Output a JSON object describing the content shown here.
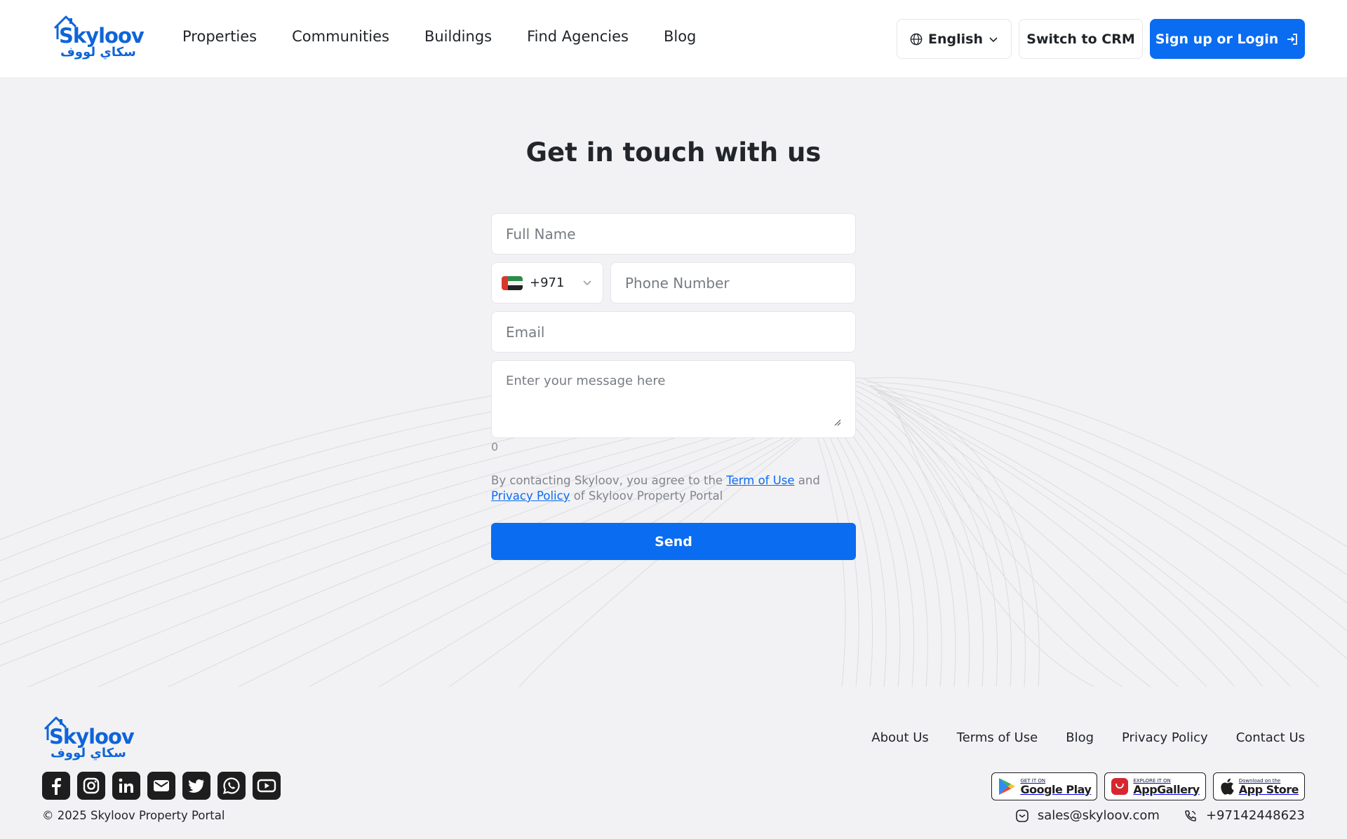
{
  "header": {
    "logo_en": "Skyloov",
    "logo_ar": "سكاي لووف",
    "nav": [
      "Properties",
      "Communities",
      "Buildings",
      "Find Agencies",
      "Blog"
    ],
    "language": "English",
    "crm_label": "Switch to CRM",
    "login_label": "Sign up or Login"
  },
  "form": {
    "title": "Get in touch with us",
    "full_name_placeholder": "Full Name",
    "country_code": "+971",
    "phone_placeholder": "Phone Number",
    "email_placeholder": "Email",
    "message_placeholder": "Enter your message here",
    "char_count": "0",
    "legal_prefix": "By contacting Skyloov, you agree to the ",
    "terms_link": "Term of Use",
    "legal_and": " and ",
    "privacy_link": "Privacy Policy",
    "legal_suffix": " of Skyloov Property Portal",
    "send_label": "Send"
  },
  "footer": {
    "logo_en": "Skyloov",
    "logo_ar": "سكاي لووف",
    "links": [
      "About Us",
      "Terms of Use",
      "Blog",
      "Privacy Policy",
      "Contact Us"
    ],
    "social": [
      "facebook-icon",
      "instagram-icon",
      "linkedin-icon",
      "mail-icon",
      "twitter-icon",
      "whatsapp-icon",
      "youtube-icon"
    ],
    "copyright": "© 2025 Skyloov Property Portal",
    "stores": [
      {
        "small": "GET IT ON",
        "big": "Google Play"
      },
      {
        "small": "EXPLORE IT ON",
        "big": "AppGallery"
      },
      {
        "small": "Download on the",
        "big": "App Store"
      }
    ],
    "email": "sales@skyloov.com",
    "phone": "+97142448623"
  },
  "colors": {
    "brand": "#0a6cf0",
    "background": "#f2f2f5"
  }
}
